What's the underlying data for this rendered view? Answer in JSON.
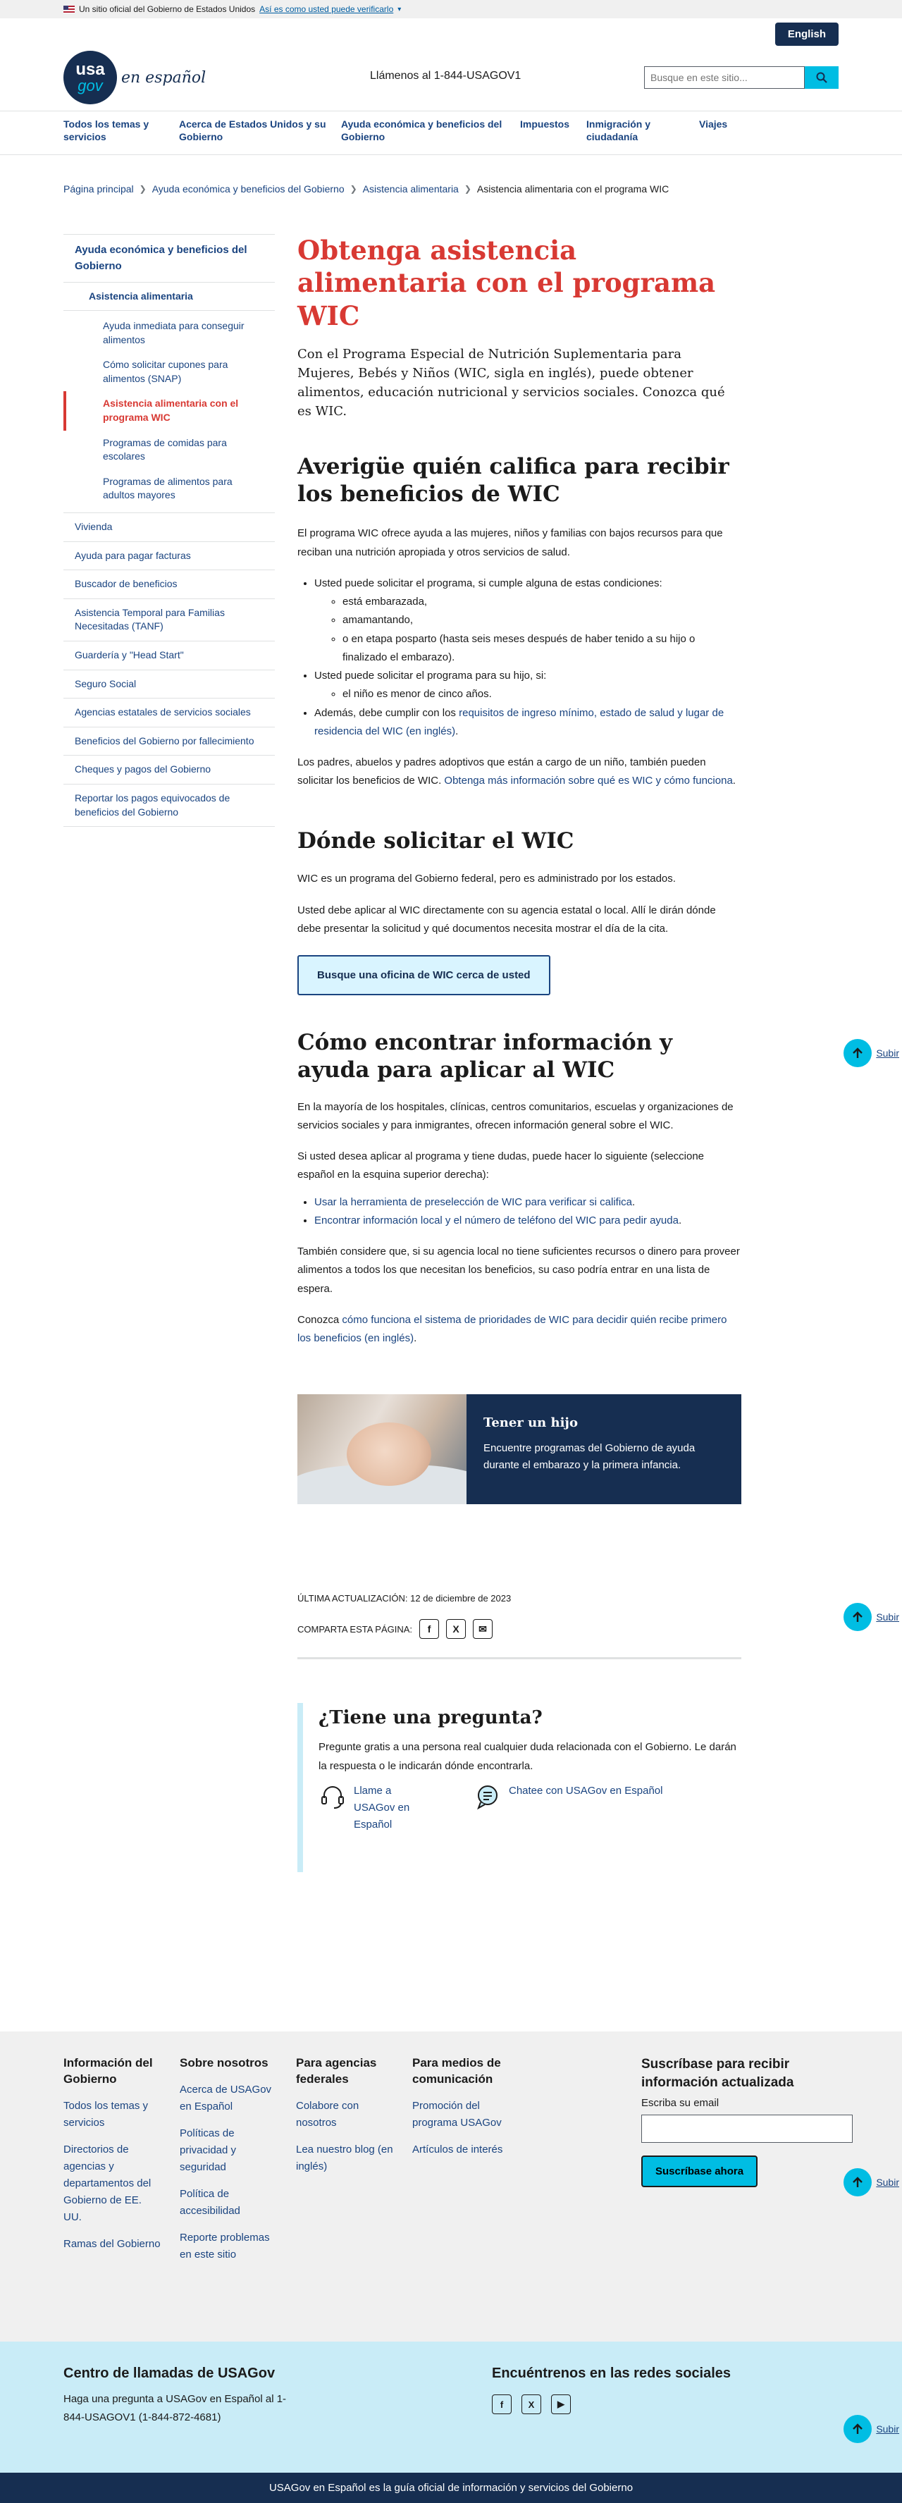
{
  "banner": {
    "text": "Un sitio oficial del Gobierno de Estados Unidos",
    "link": "Así es como usted puede verificarlo"
  },
  "header": {
    "lang_button": "English",
    "logo_usa": "usa",
    "logo_gov": "gov",
    "logo_espanol": "en español",
    "phone": "Llámenos al 1-844-USAGOV1",
    "search_placeholder": "Busque en este sitio..."
  },
  "nav": {
    "items": [
      {
        "label": "Todos los temas y servicios"
      },
      {
        "label": "Acerca de Estados Unidos y su Gobierno"
      },
      {
        "label": "Ayuda económica y beneficios del Gobierno"
      },
      {
        "label": "Impuestos"
      },
      {
        "label": "Inmigración y ciudadanía"
      },
      {
        "label": "Viajes"
      }
    ]
  },
  "breadcrumb": [
    "Página principal",
    "Ayuda económica y beneficios del Gobierno",
    "Asistencia alimentaria",
    "Asistencia alimentaria con el programa WIC"
  ],
  "sidebar": {
    "top": "Ayuda económica y beneficios del Gobierno",
    "current_section": "Asistencia alimentaria",
    "sub_items": [
      "Ayuda inmediata para conseguir alimentos",
      "Cómo solicitar cupones para alimentos (SNAP)",
      "Asistencia alimentaria con el programa WIC",
      "Programas de comidas para escolares",
      "Programas de alimentos para adultos mayores"
    ],
    "items": [
      "Vivienda",
      "Ayuda para pagar facturas",
      "Buscador de beneficios",
      "Asistencia Temporal para Familias Necesitadas (TANF)",
      "Guardería y \"Head Start\"",
      "Seguro Social",
      "Agencias estatales de servicios sociales",
      "Beneficios del Gobierno por fallecimiento",
      "Cheques y pagos del Gobierno",
      "Reportar los pagos equivocados de beneficios del Gobierno"
    ]
  },
  "main": {
    "title": "Obtenga asistencia alimentaria con el programa WIC",
    "lead": "Con el Programa Especial de Nutrición Suplementaria para Mujeres, Bebés y Niños (WIC, sigla en inglés), puede obtener alimentos, educación nutricional y servicios sociales. Conozca qué es WIC.",
    "s1": {
      "title": "Averigüe quién califica para recibir los beneficios de WIC",
      "intro": "El programa WIC ofrece ayuda a las mujeres, niños y familias con bajos recursos para que reciban una nutrición apropiada y otros servicios de salud.",
      "b1": "Usted puede solicitar el programa, si cumple alguna de estas condiciones:",
      "b1_sub": [
        "está embarazada,",
        "amamantando,",
        "o en etapa posparto (hasta seis meses después de haber tenido a su hijo o finalizado el embarazo)."
      ],
      "b2": "Usted puede solicitar el programa para su hijo, si:",
      "b2_sub": [
        "el niño es menor de cinco años."
      ],
      "b3_pre": "Además, debe cumplir con los ",
      "b3_link": "requisitos de ingreso mínimo, estado de salud y lugar de residencia del WIC (en inglés)",
      "b3_post": ".",
      "p2_pre": "Los padres, abuelos y padres adoptivos que están a cargo de un niño, también pueden solicitar los beneficios de WIC. ",
      "p2_link": "Obtenga más información sobre qué es WIC y cómo funciona",
      "p2_post": "."
    },
    "s2": {
      "title": "Dónde solicitar el WIC",
      "p1": "WIC es un programa del Gobierno federal, pero es administrado por los estados.",
      "p2": "Usted debe aplicar al WIC directamente con su agencia estatal o local. Allí le dirán dónde debe presentar la solicitud y qué documentos necesita mostrar el día de la cita.",
      "cta": "Busque una oficina de WIC cerca de usted"
    },
    "s3": {
      "title": "Cómo encontrar información y ayuda para aplicar al WIC",
      "p1": "En la mayoría de los hospitales, clínicas, centros comunitarios, escuelas y organizaciones de servicios sociales y para inmigrantes, ofrecen información general sobre el WIC.",
      "p2": "Si usted desea aplicar al programa y tiene dudas, puede hacer lo siguiente (seleccione español en la esquina superior derecha):",
      "links": [
        "Usar la herramienta de preselección de WIC para verificar si califica",
        "Encontrar información local y el número de teléfono del WIC para pedir ayuda"
      ],
      "p3": "También considere que, si su agencia local no tiene suficientes recursos o dinero para proveer alimentos a todos los que necesitan los beneficios, su caso podría entrar en una lista de espera.",
      "p4_pre": "Conozca ",
      "p4_link": "cómo funciona el sistema de prioridades de WIC para decidir quién recibe primero los beneficios (en inglés)",
      "p4_post": "."
    },
    "promo": {
      "title": "Tener un hijo",
      "text": "Encuentre programas del Gobierno de ayuda durante el embarazo y la primera infancia."
    },
    "updated": "ÚLTIMA ACTUALIZACIÓN: 12 de diciembre de 2023",
    "share": "COMPARTA ESTA PÁGINA:",
    "question": {
      "title": "¿Tiene una pregunta?",
      "text": "Pregunte gratis a una persona real cualquier duda relacionada con el Gobierno. Le darán la respuesta o le indicarán dónde encontrarla.",
      "call": "Llame a USAGov en Español",
      "chat": "Chatee con USAGov en Español"
    }
  },
  "subir": "Subir",
  "footer": {
    "cols": [
      {
        "title": "Información del Gobierno",
        "links": [
          "Todos los temas y servicios",
          "Directorios de agencias y departamentos del Gobierno de EE. UU.",
          "Ramas del Gobierno"
        ]
      },
      {
        "title": "Sobre nosotros",
        "links": [
          "Acerca de USAGov en Español",
          "Políticas de privacidad y seguridad",
          "Política de accesibilidad",
          "Reporte problemas en este sitio"
        ]
      },
      {
        "title": "Para agencias federales",
        "links": [
          "Colabore con nosotros",
          "Lea nuestro blog (en inglés)"
        ]
      },
      {
        "title": "Para medios de comunicación",
        "links": [
          "Promoción del programa USAGov",
          "Artículos de interés"
        ]
      }
    ],
    "subscribe": {
      "title": "Suscríbase para recibir información actualizada",
      "label": "Escriba su email",
      "button": "Suscríbase ahora"
    },
    "contact": {
      "title": "Centro de llamadas de USAGov",
      "text": "Haga una pregunta a USAGov en Español al 1-844-USAGOV1 (1-844-872-4681)",
      "social_title": "Encuéntrenos en las redes sociales"
    },
    "bottom": "USAGov en Español es la guía oficial de información y servicios del Gobierno"
  },
  "colors": {
    "accent_red": "#d83933",
    "navy": "#162e51",
    "cyan": "#00bde3",
    "link": "#1a4480"
  }
}
